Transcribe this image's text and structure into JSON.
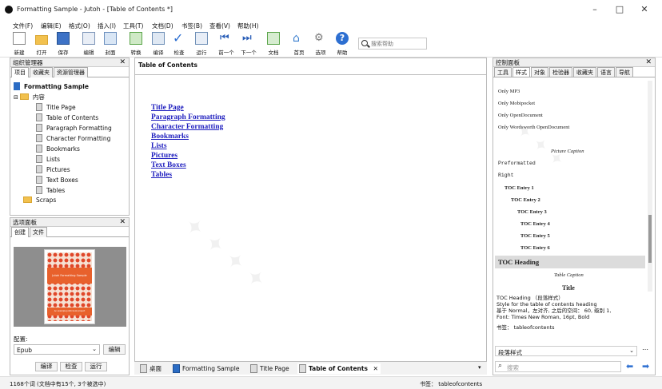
{
  "window": {
    "title": "Formatting Sample - Jutoh - [Table of Contents *]",
    "minimize": "–",
    "maximize": "□",
    "close": "✕"
  },
  "menu": [
    "文件(F)",
    "编辑(E)",
    "格式(O)",
    "插入(I)",
    "工具(T)",
    "文档(D)",
    "书签(B)",
    "查看(V)",
    "帮助(H)"
  ],
  "toolbar": {
    "buttons": [
      {
        "label": "新建",
        "icon": "new-file-icon"
      },
      {
        "label": "打开",
        "icon": "open-folder-icon"
      },
      {
        "label": "保存",
        "icon": "save-icon"
      },
      {
        "label": "编辑",
        "icon": "edit-icon"
      },
      {
        "label": "封面",
        "icon": "cover-icon"
      },
      {
        "label": "转换",
        "icon": "convert-icon"
      },
      {
        "label": "编译",
        "icon": "compile-icon"
      },
      {
        "label": "检查",
        "icon": "check-icon"
      },
      {
        "label": "运行",
        "icon": "run-icon"
      },
      {
        "label": "前一个",
        "icon": "previous-icon"
      },
      {
        "label": "下一个",
        "icon": "next-icon"
      },
      {
        "label": "文档",
        "icon": "document-icon"
      },
      {
        "label": "首页",
        "icon": "home-icon"
      },
      {
        "label": "选项",
        "icon": "options-icon"
      },
      {
        "label": "帮助",
        "icon": "help-icon"
      }
    ],
    "search_placeholder": "搜索帮助"
  },
  "library": {
    "title": "组织管理器",
    "tabs": [
      "项目",
      "收藏夹",
      "资源管理器"
    ],
    "project": "Formatting Sample",
    "content_folder": "内容",
    "items": [
      "Title Page",
      "Table of Contents",
      "Paragraph Formatting",
      "Character Formatting",
      "Bookmarks",
      "Lists",
      "Pictures",
      "Text Boxes",
      "Tables"
    ],
    "scraps": "Scraps"
  },
  "options": {
    "title": "选项面板",
    "tabs": [
      "创建",
      "文件"
    ],
    "cover_title": "Jutoh Formatting Sample",
    "cover_subtitle": "An example Jutoh book project",
    "config_label": "配置:",
    "config_value": "Epub",
    "edit_button": "编辑",
    "buttons": [
      "编译",
      "检查",
      "运行"
    ]
  },
  "document": {
    "heading": "Table of Contents",
    "toc": [
      "Title Page",
      "Paragraph Formatting",
      "Character Formatting",
      "Bookmarks",
      "Lists",
      "Pictures",
      "Text Boxes",
      "Tables"
    ],
    "tabs": [
      "桌面",
      "Formatting Sample",
      "Title Page",
      "Table of Contents"
    ]
  },
  "right_panel": {
    "title": "控制面板",
    "tabs": [
      "工具",
      "样式",
      "对象",
      "检验器",
      "收藏夹",
      "语言",
      "导航"
    ],
    "styles": [
      "Only MP3",
      "Only Mobipocket",
      "Only OpenDocument",
      "Only Wordsworth OpenDocument",
      "",
      "Picture Caption",
      "Preformatted",
      "Right",
      "TOC Entry 1",
      "TOC Entry 2",
      "TOC Entry 3",
      "TOC Entry 4",
      "TOC Entry 5",
      "TOC Entry 6",
      "TOC Heading",
      "Table Caption",
      "Title"
    ],
    "desc_title": "TOC Heading  （段落样式）",
    "desc_line1": "Style for the table of contents heading",
    "desc_line2": "基于 Normal，左对齐, 之后的空间： 60, 级别 1,",
    "desc_line3": "Font: Times New Roman, 16pt, Bold",
    "bookmark": "书签： tableofcontents",
    "style_type": "段落样式",
    "search_placeholder": "搜索"
  },
  "status": {
    "left": "1168个词 (文档中有15个, 3个被选中)",
    "right": "书签： tableofcontents"
  }
}
